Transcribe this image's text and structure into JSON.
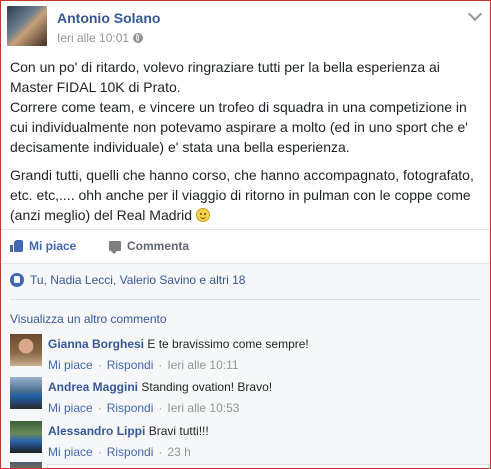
{
  "post": {
    "author": "Antonio Solano",
    "timestamp": "Ieri alle 10:01",
    "paragraphs": [
      "Con un po' di ritardo, volevo ringraziare tutti per la bella esperienza ai Master FIDAL 10K di Prato.",
      "Correre come team, e vincere un trofeo di squadra in una competizione in cui individualmente non potevamo aspirare a molto (ed in uno sport che e' decisamente individuale) e' stata una bella esperienza."
    ],
    "paragraph_last": "Grandi tutti, quelli che hanno corso, che hanno accompagnato, fotografato, etc. etc,.... ohh anche per il viaggio di ritorno in pulman con le coppe come (anzi meglio) del Real Madrid"
  },
  "actions": {
    "like_label": "Mi piace",
    "comment_label": "Commenta"
  },
  "feedback": {
    "likes_summary": "Tu, Nadia Lecci, Valerio Savino e altri 18",
    "more_comments": "Visualizza un altro commento",
    "comments": [
      {
        "name": "Gianna Borghesi",
        "text": "E te bravissimo come sempre!",
        "like": "Mi piace",
        "reply": "Rispondi",
        "time": "Ieri alle 10:11"
      },
      {
        "name": "Andrea Maggini",
        "text": "Standing ovation! Bravo!",
        "like": "Mi piace",
        "reply": "Rispondi",
        "time": "Ieri alle 10:53"
      },
      {
        "name": "Alessandro Lippi",
        "text": "Bravi tutti!!!",
        "like": "Mi piace",
        "reply": "Rispondi",
        "time": "23 h"
      }
    ]
  },
  "colors": {
    "link": "#365899",
    "action_blue": "#4267b2",
    "meta_gray": "#90949c",
    "feedback_bg": "#f6f7f9"
  },
  "icons": [
    "globe-icon",
    "chevron-down-icon",
    "like-thumb-icon",
    "comment-bubble-icon",
    "like-badge-icon",
    "smiley-emoji-icon"
  ]
}
